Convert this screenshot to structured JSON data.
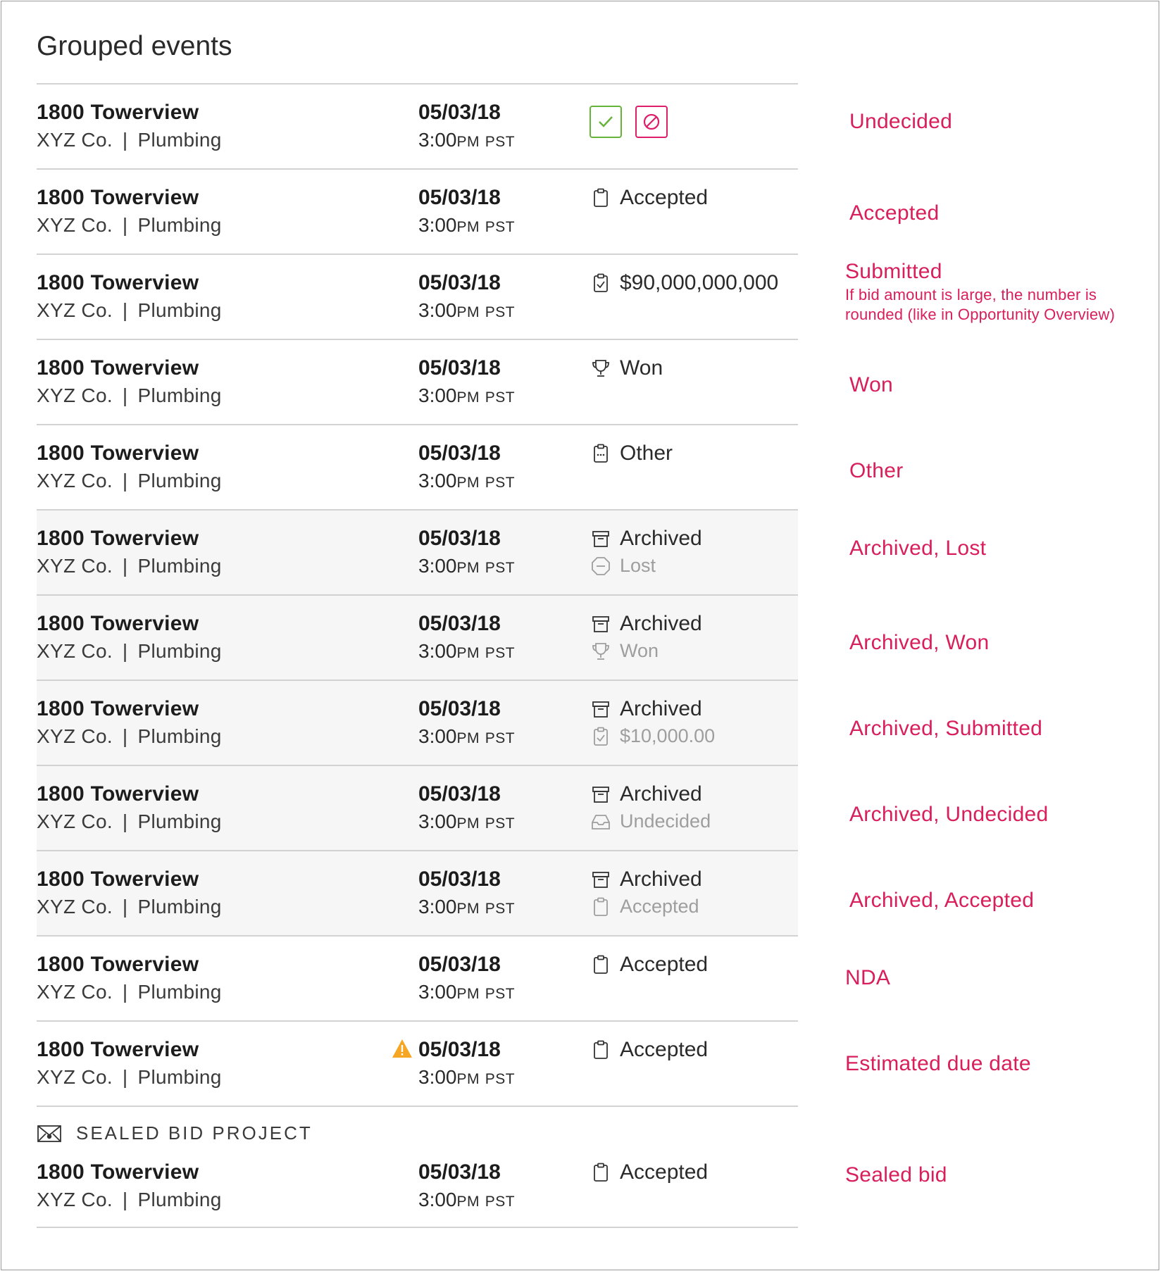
{
  "page": {
    "title": "Grouped events"
  },
  "colors": {
    "annotation": "#d81e5b",
    "accept_border": "#66b33a",
    "decline_border": "#dd1e6a",
    "warning": "#f5a623",
    "archived_row_bg": "#f6f6f6"
  },
  "rows": [
    {
      "project": "1800 Towerview",
      "company": "XYZ Co.",
      "sep": "|",
      "trade": "Plumbing",
      "date": "05/03/18",
      "time": "3:00",
      "ampm": "PM",
      "tz": "PST",
      "status": "",
      "substatus": ""
    },
    {
      "project": "1800 Towerview",
      "company": "XYZ Co.",
      "sep": "|",
      "trade": "Plumbing",
      "date": "05/03/18",
      "time": "3:00",
      "ampm": "PM",
      "tz": "PST",
      "status": "Accepted",
      "status_icon": "clipboard-icon",
      "substatus": ""
    },
    {
      "project": "1800 Towerview",
      "company": "XYZ Co.",
      "sep": "|",
      "trade": "Plumbing",
      "date": "05/03/18",
      "time": "3:00",
      "ampm": "PM",
      "tz": "PST",
      "status": "$90,000,000,000",
      "status_icon": "clipboard-check-icon",
      "substatus": ""
    },
    {
      "project": "1800 Towerview",
      "company": "XYZ Co.",
      "sep": "|",
      "trade": "Plumbing",
      "date": "05/03/18",
      "time": "3:00",
      "ampm": "PM",
      "tz": "PST",
      "status": "Won",
      "status_icon": "trophy-icon",
      "substatus": ""
    },
    {
      "project": "1800 Towerview",
      "company": "XYZ Co.",
      "sep": "|",
      "trade": "Plumbing",
      "date": "05/03/18",
      "time": "3:00",
      "ampm": "PM",
      "tz": "PST",
      "status": "Other",
      "status_icon": "clipboard-dots-icon",
      "substatus": ""
    },
    {
      "project": "1800 Towerview",
      "company": "XYZ Co.",
      "sep": "|",
      "trade": "Plumbing",
      "date": "05/03/18",
      "time": "3:00",
      "ampm": "PM",
      "tz": "PST",
      "status": "Archived",
      "status_icon": "archive-box-icon",
      "substatus": "Lost",
      "substatus_icon": "minus-octagon-icon"
    },
    {
      "project": "1800 Towerview",
      "company": "XYZ Co.",
      "sep": "|",
      "trade": "Plumbing",
      "date": "05/03/18",
      "time": "3:00",
      "ampm": "PM",
      "tz": "PST",
      "status": "Archived",
      "status_icon": "archive-box-icon",
      "substatus": "Won",
      "substatus_icon": "trophy-icon"
    },
    {
      "project": "1800 Towerview",
      "company": "XYZ Co.",
      "sep": "|",
      "trade": "Plumbing",
      "date": "05/03/18",
      "time": "3:00",
      "ampm": "PM",
      "tz": "PST",
      "status": "Archived",
      "status_icon": "archive-box-icon",
      "substatus": "$10,000.00",
      "substatus_icon": "clipboard-check-icon"
    },
    {
      "project": "1800 Towerview",
      "company": "XYZ Co.",
      "sep": "|",
      "trade": "Plumbing",
      "date": "05/03/18",
      "time": "3:00",
      "ampm": "PM",
      "tz": "PST",
      "status": "Archived",
      "status_icon": "archive-box-icon",
      "substatus": "Undecided",
      "substatus_icon": "inbox-tray-icon"
    },
    {
      "project": "1800 Towerview",
      "company": "XYZ Co.",
      "sep": "|",
      "trade": "Plumbing",
      "date": "05/03/18",
      "time": "3:00",
      "ampm": "PM",
      "tz": "PST",
      "status": "Archived",
      "status_icon": "archive-box-icon",
      "substatus": "Accepted",
      "substatus_icon": "clipboard-icon"
    },
    {
      "project": "1800 Towerview",
      "company": "XYZ Co.",
      "sep": "|",
      "trade": "Plumbing",
      "date": "05/03/18",
      "time": "3:00",
      "ampm": "PM",
      "tz": "PST",
      "status": "Accepted",
      "status_icon": "clipboard-icon",
      "substatus": ""
    },
    {
      "project": "1800 Towerview",
      "company": "XYZ Co.",
      "sep": "|",
      "trade": "Plumbing",
      "date": "05/03/18",
      "time": "3:00",
      "ampm": "PM",
      "tz": "PST",
      "status": "Accepted",
      "status_icon": "clipboard-icon",
      "substatus": "",
      "warning_icon": "warning-triangle-icon"
    },
    {
      "tag": "SEALED BID PROJECT",
      "tag_icon": "sealed-envelope-icon",
      "project": "1800 Towerview",
      "company": "XYZ Co.",
      "sep": "|",
      "trade": "Plumbing",
      "date": "05/03/18",
      "time": "3:00",
      "ampm": "PM",
      "tz": "PST",
      "status": "Accepted",
      "status_icon": "clipboard-icon",
      "substatus": ""
    }
  ],
  "actions": {
    "accept_icon": "check-icon",
    "decline_icon": "no-entry-icon"
  },
  "annotations": [
    {
      "label": "Undecided"
    },
    {
      "label": "Accepted"
    },
    {
      "label": "Submitted",
      "sub1": "If bid amount is large, the number is",
      "sub2": "rounded (like in Opportunity Overview)"
    },
    {
      "label": "Won"
    },
    {
      "label": "Other"
    },
    {
      "label": "Archived, Lost"
    },
    {
      "label": "Archived, Won"
    },
    {
      "label": "Archived, Submitted"
    },
    {
      "label": "Archived, Undecided"
    },
    {
      "label": "Archived, Accepted"
    },
    {
      "label": "NDA"
    },
    {
      "label": "Estimated due date"
    },
    {
      "label": "Sealed bid"
    }
  ]
}
